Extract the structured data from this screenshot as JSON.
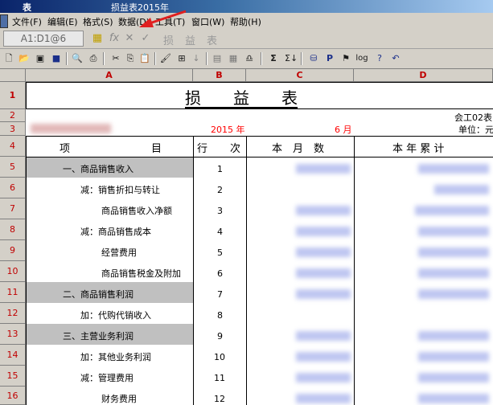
{
  "window": {
    "title_left": "表",
    "title_mid": "损益表2015年"
  },
  "menu": [
    {
      "label": "文件(F)"
    },
    {
      "label": "编辑(E)"
    },
    {
      "label": "格式(S)"
    },
    {
      "label": "数据(D)"
    },
    {
      "label": "工具(T)"
    },
    {
      "label": "窗口(W)"
    },
    {
      "label": "帮助(H)"
    }
  ],
  "formula_bar": {
    "cell_ref": "A1:D1@6",
    "content": "损益表"
  },
  "columns": [
    "A",
    "B",
    "C",
    "D"
  ],
  "rows": [
    "1",
    "2",
    "3",
    "4",
    "5",
    "6",
    "7",
    "8",
    "9",
    "10",
    "11",
    "12",
    "13",
    "14",
    "15",
    "16"
  ],
  "sheet": {
    "title": "损　　益　　表",
    "form_code": "会工02表",
    "year": "2015 年",
    "month": "6 月",
    "unit": "单位：元",
    "headers": {
      "item_left": "项",
      "item_right": "目",
      "line_left": "行",
      "line_right": "次",
      "month": "本　月　数",
      "year": "本 年 累 计"
    },
    "lines": [
      {
        "item": "一、商品销售收入",
        "no": "1"
      },
      {
        "item": "减：销售折扣与转让",
        "no": "2"
      },
      {
        "item": "商品销售收入净额",
        "no": "3"
      },
      {
        "item": "减：商品销售成本",
        "no": "4"
      },
      {
        "item": "经营费用",
        "no": "5"
      },
      {
        "item": "商品销售税金及附加",
        "no": "6"
      },
      {
        "item": "二、商品销售利润",
        "no": "7"
      },
      {
        "item": "加：代购代销收入",
        "no": "8"
      },
      {
        "item": "三、主营业务利润",
        "no": "9"
      },
      {
        "item": "加：其他业务利润",
        "no": "10"
      },
      {
        "item": "减：管理费用",
        "no": "11"
      },
      {
        "item": "财务费用",
        "no": "12"
      }
    ]
  },
  "colors": {
    "accent_red": "#c00000",
    "shade": "#c0c0c0",
    "annotation_arrow": "#e02020"
  }
}
